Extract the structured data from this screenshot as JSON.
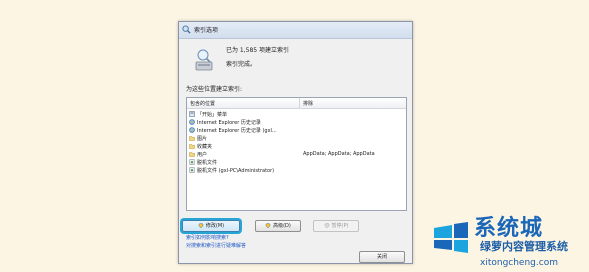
{
  "window": {
    "title": "索引选项"
  },
  "status": {
    "count_text": "已为 1,585 项建立索引",
    "state_text": "索引完成。"
  },
  "section_label": "为这些位置建立索引:",
  "list": {
    "header_included": "包含的位置",
    "header_excluded": "排除",
    "rows": [
      {
        "label": "「开始」菜单",
        "excluded": "",
        "icon": "start-menu-icon"
      },
      {
        "label": "Internet Explorer 历史记录",
        "excluded": "",
        "icon": "ie-history-icon"
      },
      {
        "label": "Internet Explorer 历史记录 (gxl...",
        "excluded": "",
        "icon": "ie-history-icon"
      },
      {
        "label": "图片",
        "excluded": "",
        "icon": "folder-icon"
      },
      {
        "label": "收藏夹",
        "excluded": "",
        "icon": "folder-icon"
      },
      {
        "label": "用户",
        "excluded": "AppData; AppData; AppData",
        "icon": "folder-icon"
      },
      {
        "label": "脱机文件",
        "excluded": "",
        "icon": "offline-files-icon"
      },
      {
        "label": "脱机文件 (gxl-PC\\Administrator)",
        "excluded": "",
        "icon": "offline-files-icon"
      }
    ]
  },
  "buttons": {
    "modify": "修改(M)",
    "advanced": "高级(D)",
    "pause": "暂停(P)",
    "close": "关闭"
  },
  "links": {
    "how_index": "索引如何影响搜索?",
    "troubleshoot": "对搜索和索引进行疑难解答"
  },
  "watermark": {
    "brand": "系统城",
    "line": "绿萝内容管理系统",
    "site": "xitongcheng.com"
  },
  "colors": {
    "highlight": "#27a6d6",
    "link": "#1f58c8",
    "watermark": "#1a66b8"
  }
}
